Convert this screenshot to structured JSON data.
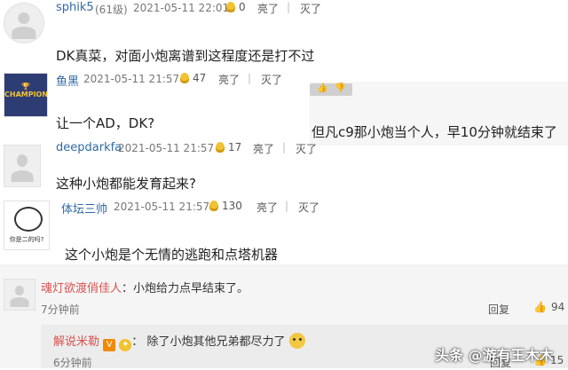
{
  "comments": [
    {
      "username": "sphik5",
      "level": "(61级)",
      "time": "2021-05-11 22:01",
      "votes": "0",
      "like_label": "亮了",
      "reply_label": "灭了",
      "content": "DK真菜，对面小炮离谱到这程度还是打不过"
    },
    {
      "username": "鱼黑",
      "time": "2021-05-11 21:57",
      "votes": "47",
      "like_label": "亮了",
      "reply_label": "灭了",
      "content": "让一个AD，DK?",
      "avatar_text": "CHAMPIONS"
    },
    {
      "username": "deepdarkfa",
      "time": "2021-05-11 21:57",
      "votes": "17",
      "like_label": "亮了",
      "reply_label": "灭了",
      "content": "这种小炮都能发育起来?"
    },
    {
      "username": "体坛三帅",
      "time": "2021-05-11 21:57",
      "votes": "130",
      "like_label": "亮了",
      "reply_label": "灭了",
      "content": "这个小炮是个无情的逃跑和点塔机器",
      "avatar_text": "你是二的吗?"
    }
  ],
  "overlay_comment": {
    "content": "但凡c9那小炮当个人，早10分钟就结束了"
  },
  "reply_thread": {
    "username": "魂灯欲渡俏佳人",
    "content": "小炮给力点早结束了。",
    "time": "7分钟前",
    "reply_label": "回复",
    "like_count": "94",
    "sub_reply": {
      "username": "解说米勒",
      "content": "除了小炮其他兄弟都尽力了",
      "time": "6分钟前",
      "reply_label": "回复",
      "like_count": "15"
    }
  },
  "watermark": "头条 @游有王木木",
  "icons": {
    "vote": "lightbulb-icon",
    "like": "thumb-up-icon",
    "verified": "verified-badge-icon"
  }
}
